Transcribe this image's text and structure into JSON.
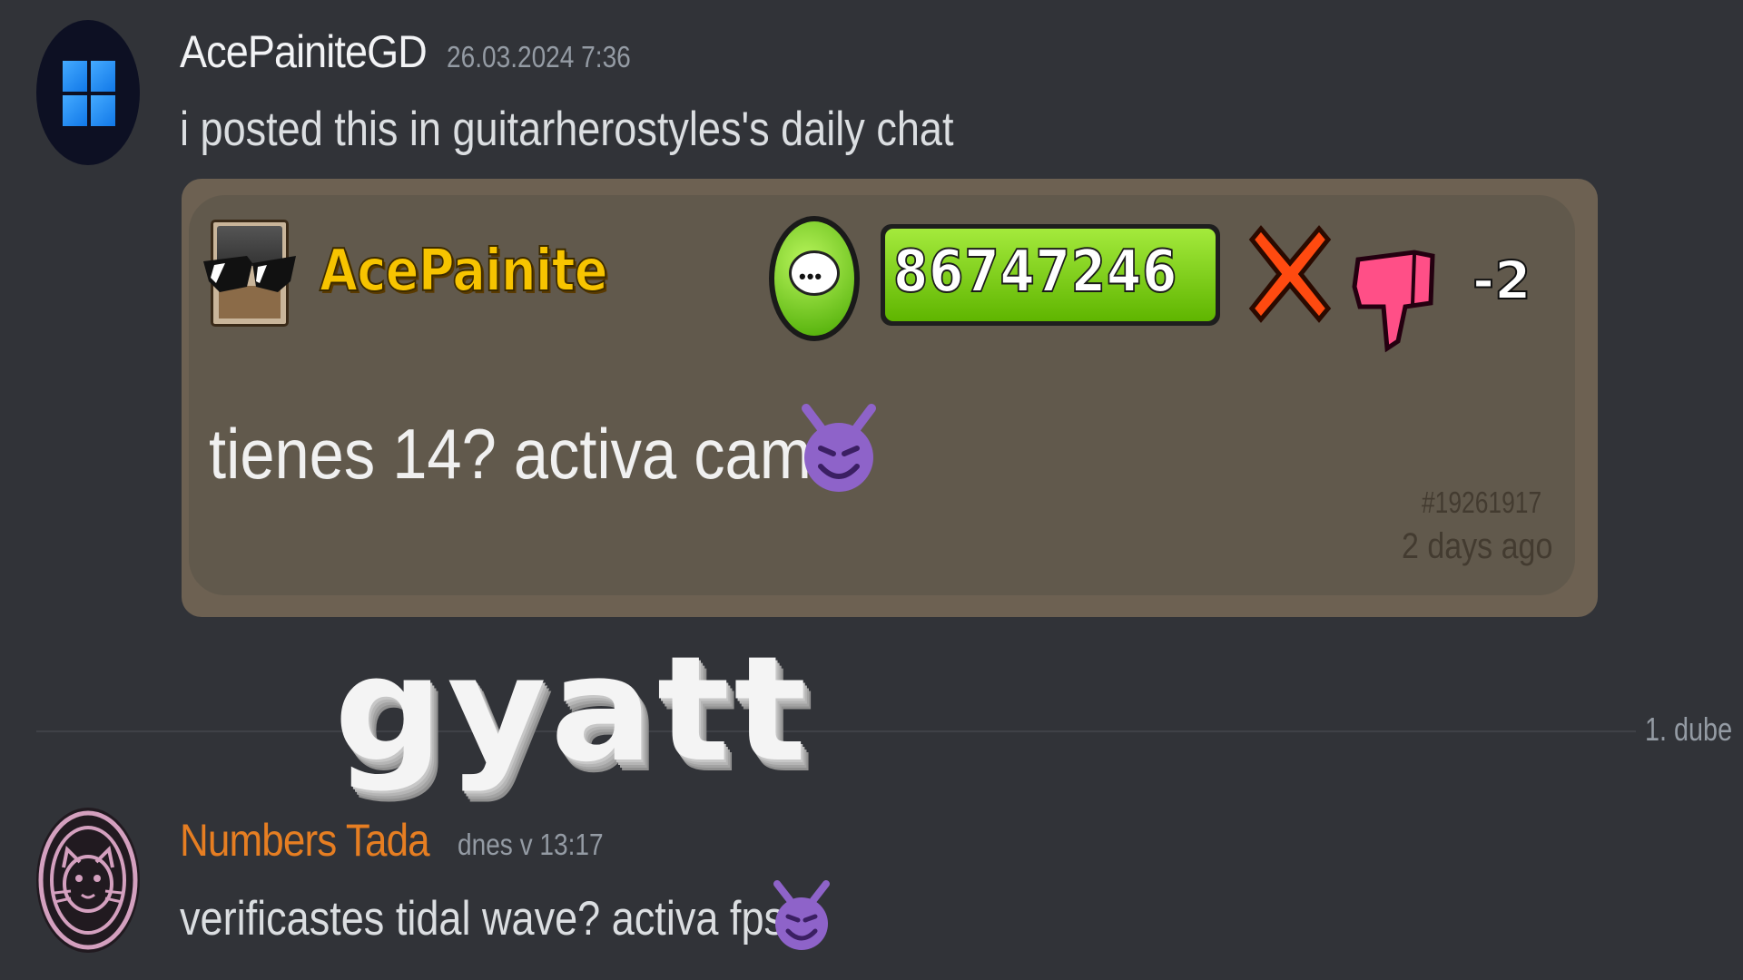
{
  "messages": [
    {
      "username": "AcePainiteGD",
      "timestamp": "26.03.2024 7:36",
      "text": "i posted this in guitarherostyles's daily chat",
      "avatar_icon": "windows-logo"
    },
    {
      "username": "Numbers Tada",
      "username_color": "#e67e22",
      "timestamp": "dnes v 13:17",
      "text": "verificastes tidal wave? activa fps",
      "avatar_icon": "cat-face"
    }
  ],
  "embed": {
    "gd_username": "AcePainite",
    "player_id": "86747246",
    "likes": "-2",
    "comment_text": "tienes 14? activa cam",
    "comment_id": "#19261917",
    "comment_time": "2 days ago",
    "icons": [
      "glasses-icon",
      "chat-bubble-icon",
      "close-icon",
      "thumbs-down-icon",
      "devil-emoji"
    ]
  },
  "overlay_text": "gyatt",
  "divider": {
    "date": "1. dube"
  },
  "colors": {
    "background": "#313338",
    "embed_border": "#6d6152",
    "embed_fill": "#61594c",
    "gd_gold": "#f7c400",
    "gd_green": "#5fb500"
  }
}
